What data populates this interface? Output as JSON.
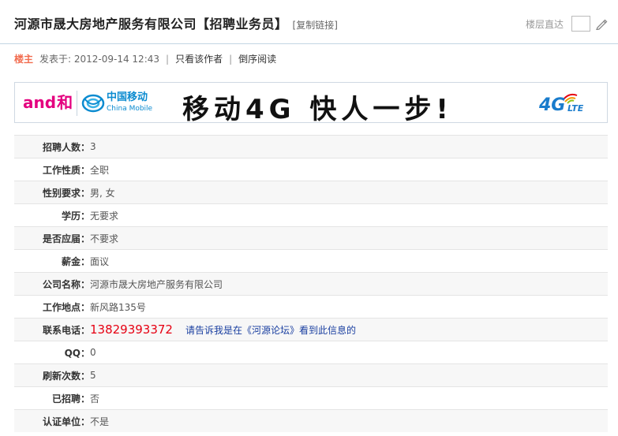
{
  "thread": {
    "title": "河源市晟大房地产服务有限公司【招聘业务员】",
    "copy_link": "[复制链接]"
  },
  "floor_jump": {
    "label": "楼层直达",
    "input_value": ""
  },
  "author": {
    "louzhu": "楼主",
    "posted": "发表于: 2012-09-14 12:43",
    "sep1": "|",
    "only_author": "只看该作者",
    "sep2": "|",
    "reverse": "倒序阅读"
  },
  "ad": {
    "and_text": "and",
    "he_text": "和",
    "cm_cn": "中国移动",
    "cm_en": "China Mobile",
    "slogan": "移动4G 快人一步!",
    "lte_main": "4G",
    "lte_sub": "LTE"
  },
  "info_rows": [
    {
      "label": "招聘人数：",
      "value": "3"
    },
    {
      "label": "工作性质：",
      "value": "全职"
    },
    {
      "label": "性别要求：",
      "value": "男, 女"
    },
    {
      "label": "学历：",
      "value": "无要求"
    },
    {
      "label": "是否应届：",
      "value": "不要求"
    },
    {
      "label": "薪金：",
      "value": "面议"
    },
    {
      "label": "公司名称：",
      "value": "河源市晟大房地产服务有限公司"
    },
    {
      "label": "工作地点：",
      "value": "新风路135号"
    },
    {
      "label": "联系电话：",
      "value": "13829393372",
      "tip": "请告诉我是在《河源论坛》看到此信息的"
    },
    {
      "label": "QQ：",
      "value": "0"
    },
    {
      "label": "刷新次数：",
      "value": "5"
    },
    {
      "label": "已招聘：",
      "value": "否"
    },
    {
      "label": "认证单位：",
      "value": "不是"
    }
  ],
  "colors": {
    "louzhu": "#f26c4f",
    "phone": "#e60012",
    "tip": "#1a3fa0",
    "brand_and": "#e4007f",
    "brand_cm": "#0b8bd0"
  }
}
